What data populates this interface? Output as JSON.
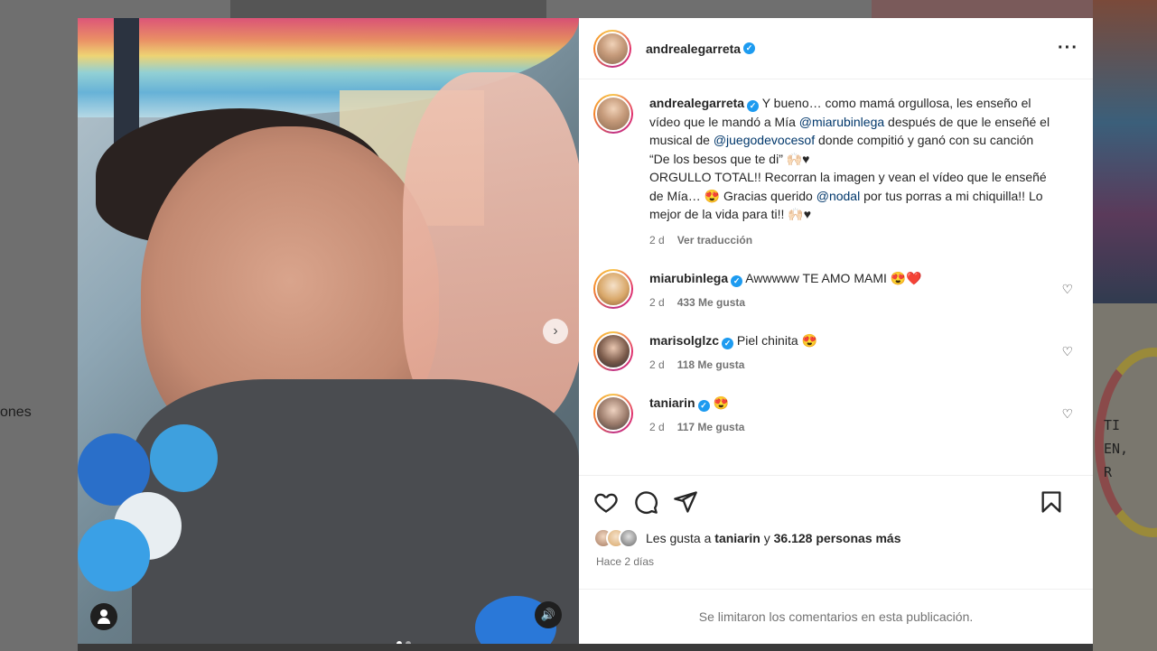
{
  "background": {
    "left_text": "ones",
    "right_text_lines": [
      "TI",
      "EN,",
      "R"
    ]
  },
  "post": {
    "username": "andrealegarreta",
    "caption": {
      "user": "andrealegarreta",
      "text_1": " Y bueno… como mamá orgullosa, les enseño el vídeo que le mandó a Mía ",
      "mention_1": "@miarubinlega",
      "text_2": " después de que le enseñé el musical de ",
      "mention_2": "@juegodevocesof",
      "text_3": " donde compitió y ganó con su canción “De los besos que te di” 🙌🏻♥",
      "text_4": "ORGULLO TOTAL!! Recorran la imagen y vean el vídeo que le enseñé de Mía… 😍 Gracias querido ",
      "mention_3": "@nodal",
      "text_5": " por tus porras a mi chiquilla!! Lo mejor de la vida para ti!! 🙌🏻♥",
      "age": "2 d",
      "translate": "Ver traducción"
    },
    "comments": [
      {
        "user": "miarubinlega",
        "text": "Awwwww TE AMO MAMI 😍❤️",
        "age": "2 d",
        "likes": "433 Me gusta"
      },
      {
        "user": "marisolglzc",
        "text": "Piel chinita 😍",
        "age": "2 d",
        "likes": "118 Me gusta"
      },
      {
        "user": "taniarin",
        "text": "😍",
        "age": "2 d",
        "likes": "117 Me gusta"
      }
    ],
    "likes": {
      "prefix": "Les gusta a ",
      "user": "taniarin",
      "middle": " y ",
      "count": "36.128 personas más"
    },
    "time_ago": "Hace 2 días",
    "comments_limited": "Se limitaron los comentarios en esta publicación.",
    "carousel": {
      "current": 1,
      "total": 2
    }
  },
  "icons": {
    "verified": "verified-badge-icon",
    "more": "more-options-icon",
    "like": "heart-icon",
    "comment": "comment-icon",
    "share": "share-icon",
    "save": "bookmark-icon",
    "next": "chevron-right-icon",
    "tag": "user-tag-icon",
    "audio": "volume-icon"
  },
  "colors": {
    "verified": "#1d9bf0",
    "mention": "#00376b",
    "muted": "#737373"
  }
}
